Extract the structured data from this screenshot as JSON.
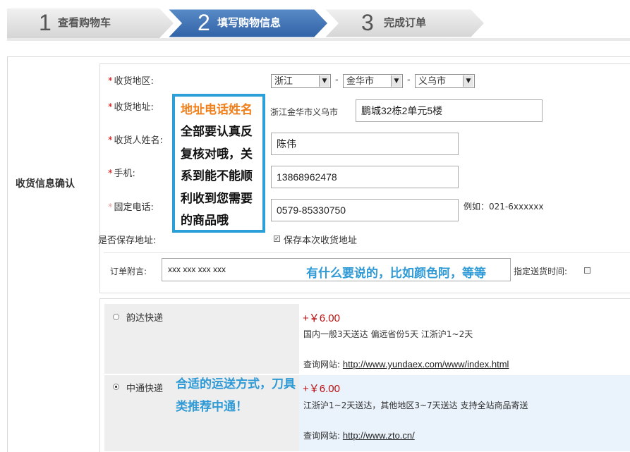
{
  "steps": [
    {
      "num": "1",
      "label": "查看购物车"
    },
    {
      "num": "2",
      "label": "填写购物信息"
    },
    {
      "num": "3",
      "label": "完成订单"
    }
  ],
  "section_label": "收货信息确认",
  "form": {
    "region_label": "收货地区:",
    "province": "浙江",
    "city": "金华市",
    "district": "义乌市",
    "dash": "-",
    "address_label": "收货地址:",
    "address_prefix": "浙江金华市义乌市",
    "address_value": "鹏城32栋2单元5楼",
    "name_label": "收货人姓名:",
    "name_value": "陈伟",
    "mobile_label": "手机:",
    "mobile_value": "13868962478",
    "phone_label": "固定电话:",
    "phone_value": "0579-85330750",
    "phone_example": "例如：021-6xxxxxx",
    "save_label": "是否保存地址:",
    "save_checkbox_label": "保存本次收货地址",
    "save_checked": true,
    "required_mark": "*"
  },
  "callout": {
    "highlight": "地址电话姓名",
    "body": "全部要认真反\n复核对哦，关\n系到能不能顺\n利收到您需要\n的商品哦"
  },
  "note": {
    "label": "订单附言:",
    "value": "xxx   xxx   xxx   xxx",
    "hint": "有什么要说的，比如颜色阿，等等",
    "delivery_time_label": "指定送货时间:"
  },
  "shipping": [
    {
      "name": "韵达快递",
      "selected": false,
      "price": "+￥6.00",
      "desc": "国内一般3天送达  偏远省份5天 江浙沪1~2天",
      "site_label": "查询网站:",
      "site_url": "http://www.yundaex.com/www/index.html"
    },
    {
      "name": "中通快递",
      "selected": true,
      "price": "+￥6.00",
      "desc": "江浙沪1~2天送达，其他地区3~7天送达 支持全站商品寄送",
      "site_label": "查询网站:",
      "site_url": "http://www.zto.cn/"
    }
  ],
  "shipping_hint": {
    "line1": "合适的运送方式，刀具",
    "line2": "类推荐中通！"
  },
  "colors": {
    "active_step": "#3a6fae",
    "inactive_step": "#e2e2e2",
    "callout_border": "#2b9fd8",
    "callout_highlight": "#f07f1a",
    "hint_blue": "#2f9ad6",
    "price_red": "#b81010",
    "selected_row_bg": "#eaf3fc"
  }
}
